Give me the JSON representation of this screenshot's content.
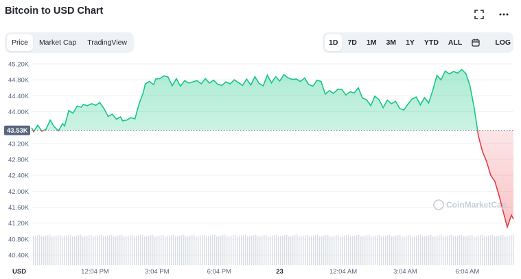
{
  "header": {
    "title": "Bitcoin to USD Chart"
  },
  "toolbar": {
    "metric_tabs": [
      "Price",
      "Market Cap",
      "TradingView"
    ],
    "active_metric": "Price",
    "range_tabs": [
      "1D",
      "7D",
      "1M",
      "3M",
      "1Y",
      "YTD",
      "ALL"
    ],
    "active_range": "1D",
    "log_label": "LOG"
  },
  "icons": {
    "expand": "fullscreen-icon",
    "more": "more-icon",
    "calendar": "calendar-icon"
  },
  "colors": {
    "up": "#16c784",
    "down": "#ea3943",
    "axis_text": "#58667e",
    "current_bg": "#58667e",
    "volume": "#c9ced6"
  },
  "watermark": "CoinMarketCap",
  "chart_data": {
    "type": "line",
    "title": "Bitcoin to USD Chart",
    "xlabel": "",
    "ylabel": "",
    "unit_label": "USD",
    "y_ticks": [
      "45.20K",
      "44.80K",
      "44.40K",
      "44.00K",
      "43.20K",
      "42.80K",
      "42.40K",
      "42.00K",
      "41.60K",
      "41.20K",
      "40.80K",
      "40.40K"
    ],
    "y_tick_values": [
      45200,
      44800,
      44400,
      44000,
      43200,
      42800,
      42400,
      42000,
      41600,
      41200,
      40800,
      40400
    ],
    "current_label": "43.53K",
    "current_value": 43530,
    "ylim": [
      40000,
      45400
    ],
    "x_ticks": [
      {
        "label": "12:04 PM",
        "hour": 3.07
      },
      {
        "label": "3:04 PM",
        "hour": 6.07
      },
      {
        "label": "6:04 PM",
        "hour": 9.07
      },
      {
        "label": "23",
        "hour": 12.0,
        "bold": true
      },
      {
        "label": "12:04 AM",
        "hour": 15.07
      },
      {
        "label": "3:04 AM",
        "hour": 18.07
      },
      {
        "label": "6:04 AM",
        "hour": 21.07
      }
    ],
    "xlim": [
      0,
      23.3
    ],
    "grid": true,
    "series": [
      {
        "x": [
          0,
          0.1,
          0.3,
          0.5,
          0.7,
          0.9,
          1.1,
          1.3,
          1.5,
          1.6,
          1.8,
          2.0,
          2.2,
          2.4,
          2.5,
          2.7,
          2.9,
          3.1,
          3.3,
          3.5,
          3.7,
          3.9,
          4.1,
          4.3,
          4.4,
          4.6,
          4.8,
          5.0,
          5.2,
          5.4,
          5.5,
          5.7,
          5.9,
          6.0,
          6.2,
          6.4,
          6.6,
          6.8,
          7.0,
          7.2,
          7.4,
          7.6,
          7.8,
          8.0,
          8.2,
          8.4,
          8.6,
          8.8,
          9.0,
          9.2,
          9.4,
          9.6,
          9.8,
          10.0,
          10.2,
          10.4,
          10.6,
          10.8,
          11.0,
          11.2,
          11.4,
          11.6,
          11.8,
          12.0,
          12.2,
          12.4,
          12.6,
          12.8,
          13.0,
          13.2,
          13.4,
          13.6,
          13.8,
          14.0,
          14.2,
          14.4,
          14.6,
          14.8,
          15.0,
          15.2,
          15.4,
          15.6,
          15.8,
          16.0,
          16.2,
          16.4,
          16.6,
          16.8,
          17.0,
          17.2,
          17.4,
          17.6,
          17.8,
          18.0,
          18.2,
          18.4,
          18.6,
          18.8,
          19.0,
          19.2,
          19.4,
          19.6,
          19.8,
          20.0,
          20.2,
          20.4,
          20.6,
          20.8,
          21.0,
          21.2,
          21.4,
          21.6,
          21.8,
          22.0,
          22.2,
          22.4,
          22.6,
          22.8,
          23.0,
          23.2,
          23.3
        ],
        "y": [
          43600,
          43500,
          43660,
          43510,
          43560,
          43790,
          43620,
          43520,
          43700,
          43640,
          44030,
          43960,
          44140,
          44110,
          44180,
          44150,
          44200,
          44160,
          44230,
          44080,
          43880,
          43940,
          43810,
          43870,
          43770,
          43790,
          43850,
          43820,
          44200,
          44480,
          44700,
          44760,
          44680,
          44820,
          44830,
          44900,
          44870,
          44650,
          44830,
          44640,
          44780,
          44720,
          44750,
          44780,
          44700,
          44830,
          44720,
          44790,
          44690,
          44660,
          44750,
          44700,
          44800,
          44730,
          44660,
          44820,
          44670,
          44880,
          44710,
          44650,
          44920,
          44720,
          44880,
          44770,
          44930,
          44850,
          44810,
          44820,
          44760,
          44850,
          44680,
          44640,
          44790,
          44760,
          44440,
          44530,
          44460,
          44560,
          44560,
          44420,
          44500,
          44470,
          44600,
          44340,
          44300,
          44150,
          44390,
          44300,
          44100,
          44290,
          44200,
          44260,
          44080,
          44040,
          44190,
          44320,
          44370,
          44170,
          44350,
          44220,
          44540,
          44910,
          44800,
          45020,
          44950,
          45010,
          44970,
          45060,
          44960,
          44650,
          44100,
          43400,
          43000,
          42750,
          42400,
          42250,
          41900,
          41500,
          41100,
          41400,
          41300
        ]
      }
    ],
    "volume": {
      "approx_relative": "near-uniform bars across the full time range"
    }
  }
}
